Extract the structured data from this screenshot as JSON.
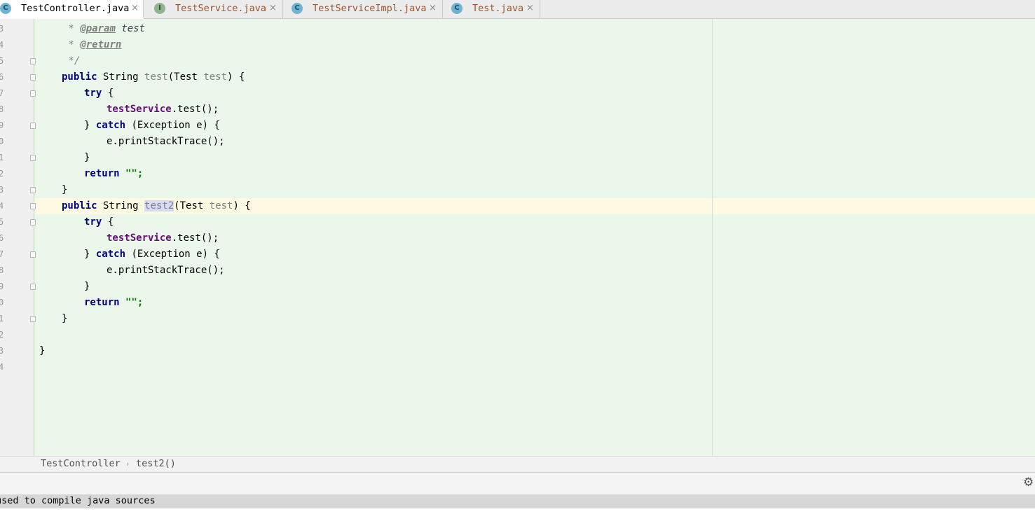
{
  "tabs": [
    {
      "label": "TestController.java",
      "icon": "C",
      "active": true
    },
    {
      "label": "TestService.java",
      "icon": "I",
      "active": false
    },
    {
      "label": "TestServiceImpl.java",
      "icon": "C",
      "active": false
    },
    {
      "label": "Test.java",
      "icon": "C",
      "active": false
    }
  ],
  "close_glyph": "×",
  "line_numbers": [
    "3",
    "4",
    "5",
    "6",
    "7",
    "8",
    "9",
    "0",
    "1",
    "2",
    "3",
    "4",
    "5",
    "6",
    "7",
    "8",
    "9",
    "0",
    "1",
    "2",
    "3",
    "4"
  ],
  "code": {
    "l3_star": " * ",
    "l3_tag": "@param",
    "l3_name": " test",
    "l4_star": " * ",
    "l4_tag": "@return",
    "l5": " */",
    "public": "public",
    "string": " String ",
    "test_name": "test",
    "test2_name": "test2",
    "sig_open": "(Test ",
    "param": "test",
    "sig_close": ") {",
    "try": "try",
    "brace_open": " {",
    "field": "testService",
    "call": ".test();",
    "close_brace": "} ",
    "catch": "catch",
    "catch_rest": " (Exception e) {",
    "print": "e.printStackTrace();",
    "brace": "}",
    "return": "return",
    "return_rest": " \"\";"
  },
  "breadcrumb": {
    "class_name": "TestController",
    "separator": "›",
    "method": "test2()"
  },
  "statusbar": {
    "text": "used to compile java sources"
  },
  "gear_glyph": "⚙"
}
